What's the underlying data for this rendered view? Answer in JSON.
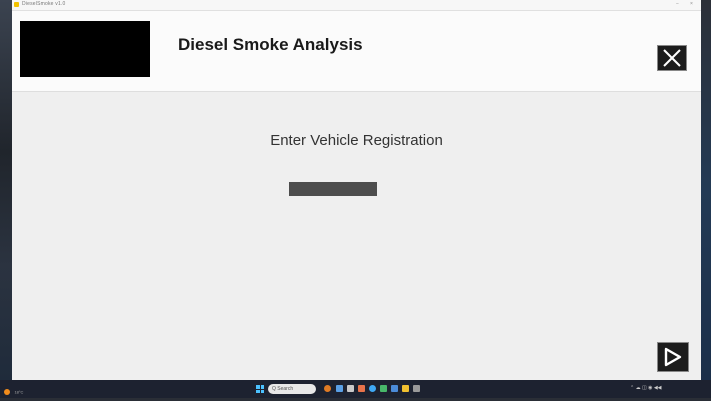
{
  "titlebar": {
    "text": "DieselSmoke v1.0",
    "controls": [
      "−",
      "×"
    ]
  },
  "header": {
    "title": "Diesel Smoke Analysis"
  },
  "main": {
    "prompt": "Enter Vehicle Registration",
    "registration_value": ""
  },
  "icons": {
    "close": "close-icon",
    "next": "play-arrow-icon"
  },
  "taskbar": {
    "weather_text": "18°C",
    "search_placeholder": "Q Search"
  },
  "colors": {
    "header_bg": "#fbfbfb",
    "main_bg": "#efefef",
    "button_bg": "#1c1c1c",
    "input_bg": "#4d4d4d",
    "taskbar_bg": "#1d2230"
  }
}
